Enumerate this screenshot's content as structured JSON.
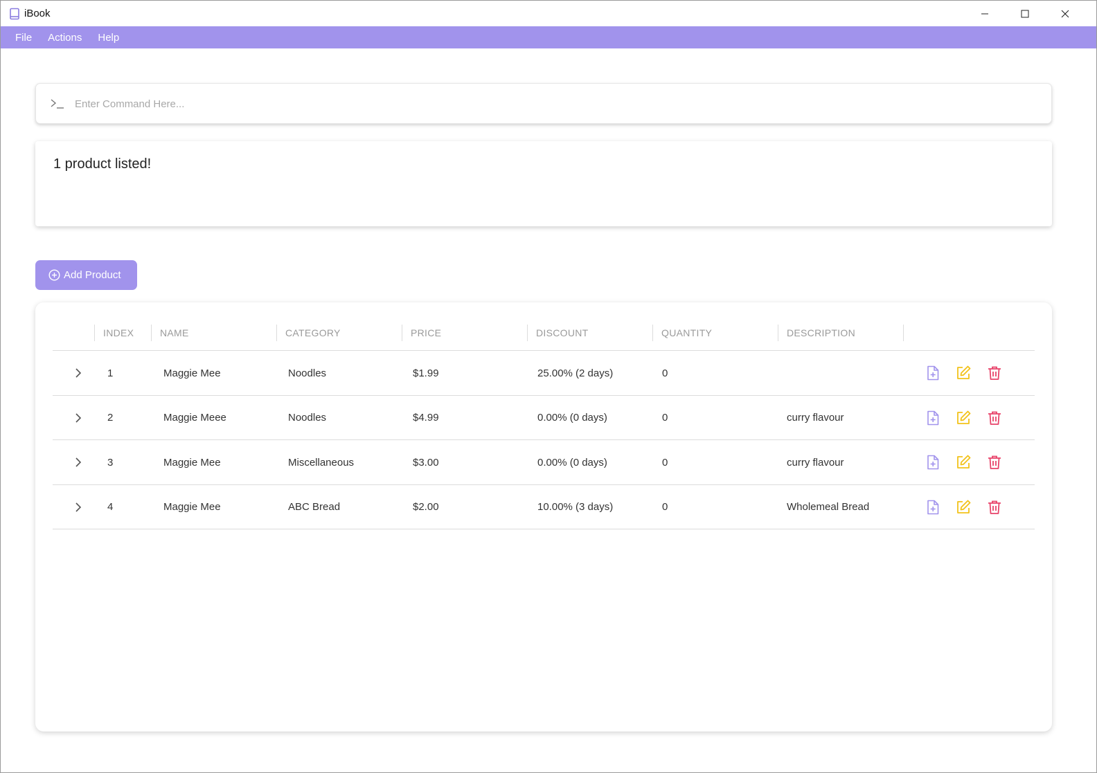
{
  "window": {
    "title": "iBook"
  },
  "menu": {
    "items": [
      "File",
      "Actions",
      "Help"
    ]
  },
  "command": {
    "placeholder": "Enter Command Here...",
    "value": ""
  },
  "result": {
    "text": "1 product listed!"
  },
  "add_button": {
    "label": "Add Product"
  },
  "table": {
    "headers": [
      "INDEX",
      "NAME",
      "CATEGORY",
      "PRICE",
      "DISCOUNT",
      "QUANTITY",
      "DESCRIPTION"
    ],
    "rows": [
      {
        "index": "1",
        "name": "Maggie Mee",
        "category": "Noodles",
        "price": "$1.99",
        "discount": "25.00% (2 days)",
        "quantity": "0",
        "description": ""
      },
      {
        "index": "2",
        "name": "Maggie Meee",
        "category": "Noodles",
        "price": "$4.99",
        "discount": "0.00% (0 days)",
        "quantity": "0",
        "description": "curry flavour"
      },
      {
        "index": "3",
        "name": "Maggie Mee",
        "category": "Miscellaneous",
        "price": "$3.00",
        "discount": "0.00% (0 days)",
        "quantity": "0",
        "description": "curry flavour"
      },
      {
        "index": "4",
        "name": "Maggie Mee",
        "category": "ABC Bread",
        "price": "$2.00",
        "discount": "10.00% (3 days)",
        "quantity": "0",
        "description": "Wholemeal Bread"
      }
    ],
    "row_actions": [
      "file-plus-icon",
      "edit-icon",
      "trash-icon"
    ]
  },
  "colors": {
    "accent": "#a193ec",
    "edit": "#f2c21a",
    "delete": "#e8436a",
    "add_item": "#a193ec"
  }
}
